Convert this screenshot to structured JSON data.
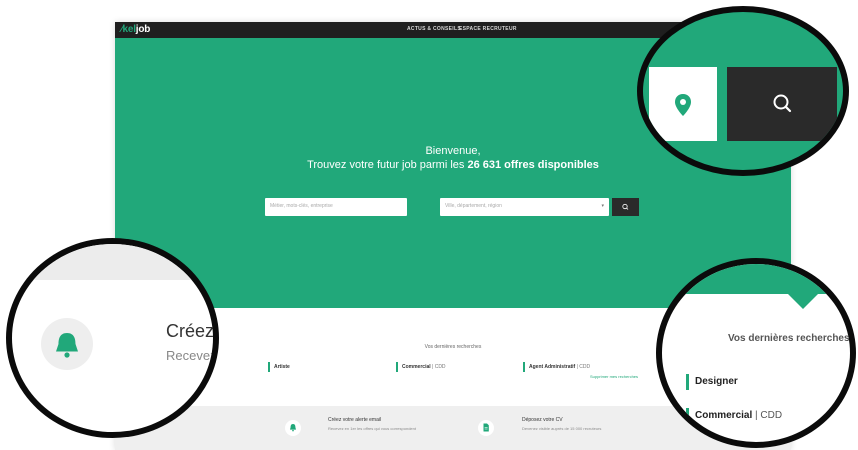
{
  "brand": {
    "logo_prefix": "kel",
    "logo_suffix": "job"
  },
  "nav": {
    "items": [
      "ACTUS & CONSEILS",
      "ESPACE RECRUTEUR"
    ]
  },
  "hero": {
    "line1": "Bienvenue,",
    "line2_prefix": "Trouvez votre futur job parmi les ",
    "line2_strong": "26 631 offres disponibles",
    "job_placeholder": "Métier, mots-clés, entreprise",
    "location_placeholder": "Ville, département, région"
  },
  "recent": {
    "title": "Vos dernières recherches",
    "items": [
      {
        "label": "Artiste",
        "sub": ""
      },
      {
        "label": "Commercial",
        "sub": " | CDD"
      },
      {
        "label": "Agent Administratif",
        "sub": " | CDD"
      }
    ],
    "delete_link": "Supprimer mes recherches"
  },
  "cta": {
    "alert_title": "Créez votre alerte email",
    "alert_sub": "Recevez en 1er les offres qui vous correspondent",
    "cv_title": "Déposez votre CV",
    "cv_sub": "Devenez visible auprès de 15 000 recruteurs"
  },
  "magnified": {
    "alert_heading": "Créez v",
    "alert_sub": "Recevez",
    "recent_title": "Vos dernières recherches",
    "items": [
      {
        "label": "Designer",
        "sub": ""
      },
      {
        "label": "Commercial",
        "sub": " | CDD"
      }
    ]
  },
  "colors": {
    "brand_green": "#21a87a",
    "dark": "#2a2a2a"
  },
  "icons": [
    "location-pin-icon",
    "search-icon",
    "bell-icon",
    "document-icon",
    "chevron-down-icon"
  ]
}
